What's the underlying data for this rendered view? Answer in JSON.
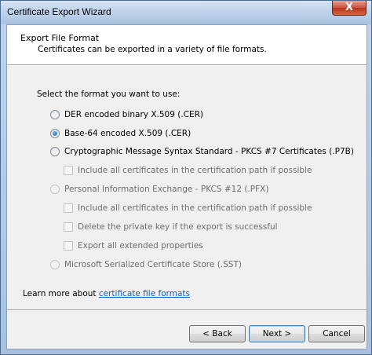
{
  "window": {
    "title": "Certificate Export Wizard",
    "close_label": "X"
  },
  "header": {
    "title": "Export File Format",
    "subtitle": "Certificates can be exported in a variety of file formats."
  },
  "body": {
    "prompt": "Select the format you want to use:",
    "options": [
      {
        "label": "DER encoded binary X.509 (.CER)",
        "selected": false,
        "enabled": true
      },
      {
        "label": "Base-64 encoded X.509 (.CER)",
        "selected": true,
        "enabled": true
      },
      {
        "label": "Cryptographic Message Syntax Standard - PKCS #7 Certificates (.P7B)",
        "selected": false,
        "enabled": true
      },
      {
        "label": "Personal Information Exchange - PKCS #12 (.PFX)",
        "selected": false,
        "enabled": false
      },
      {
        "label": "Microsoft Serialized Certificate Store (.SST)",
        "selected": false,
        "enabled": false
      }
    ],
    "p7b_checks": [
      {
        "label": "Include all certificates in the certification path if possible"
      }
    ],
    "pfx_checks": [
      {
        "label": "Include all certificates in the certification path if possible"
      },
      {
        "label": "Delete the private key if the export is successful"
      },
      {
        "label": "Export all extended properties"
      }
    ],
    "learn_more_prefix": "Learn more about ",
    "learn_more_link": "certificate file formats"
  },
  "footer": {
    "back_label": "< Back",
    "next_label": "Next >",
    "cancel_label": "Cancel"
  }
}
